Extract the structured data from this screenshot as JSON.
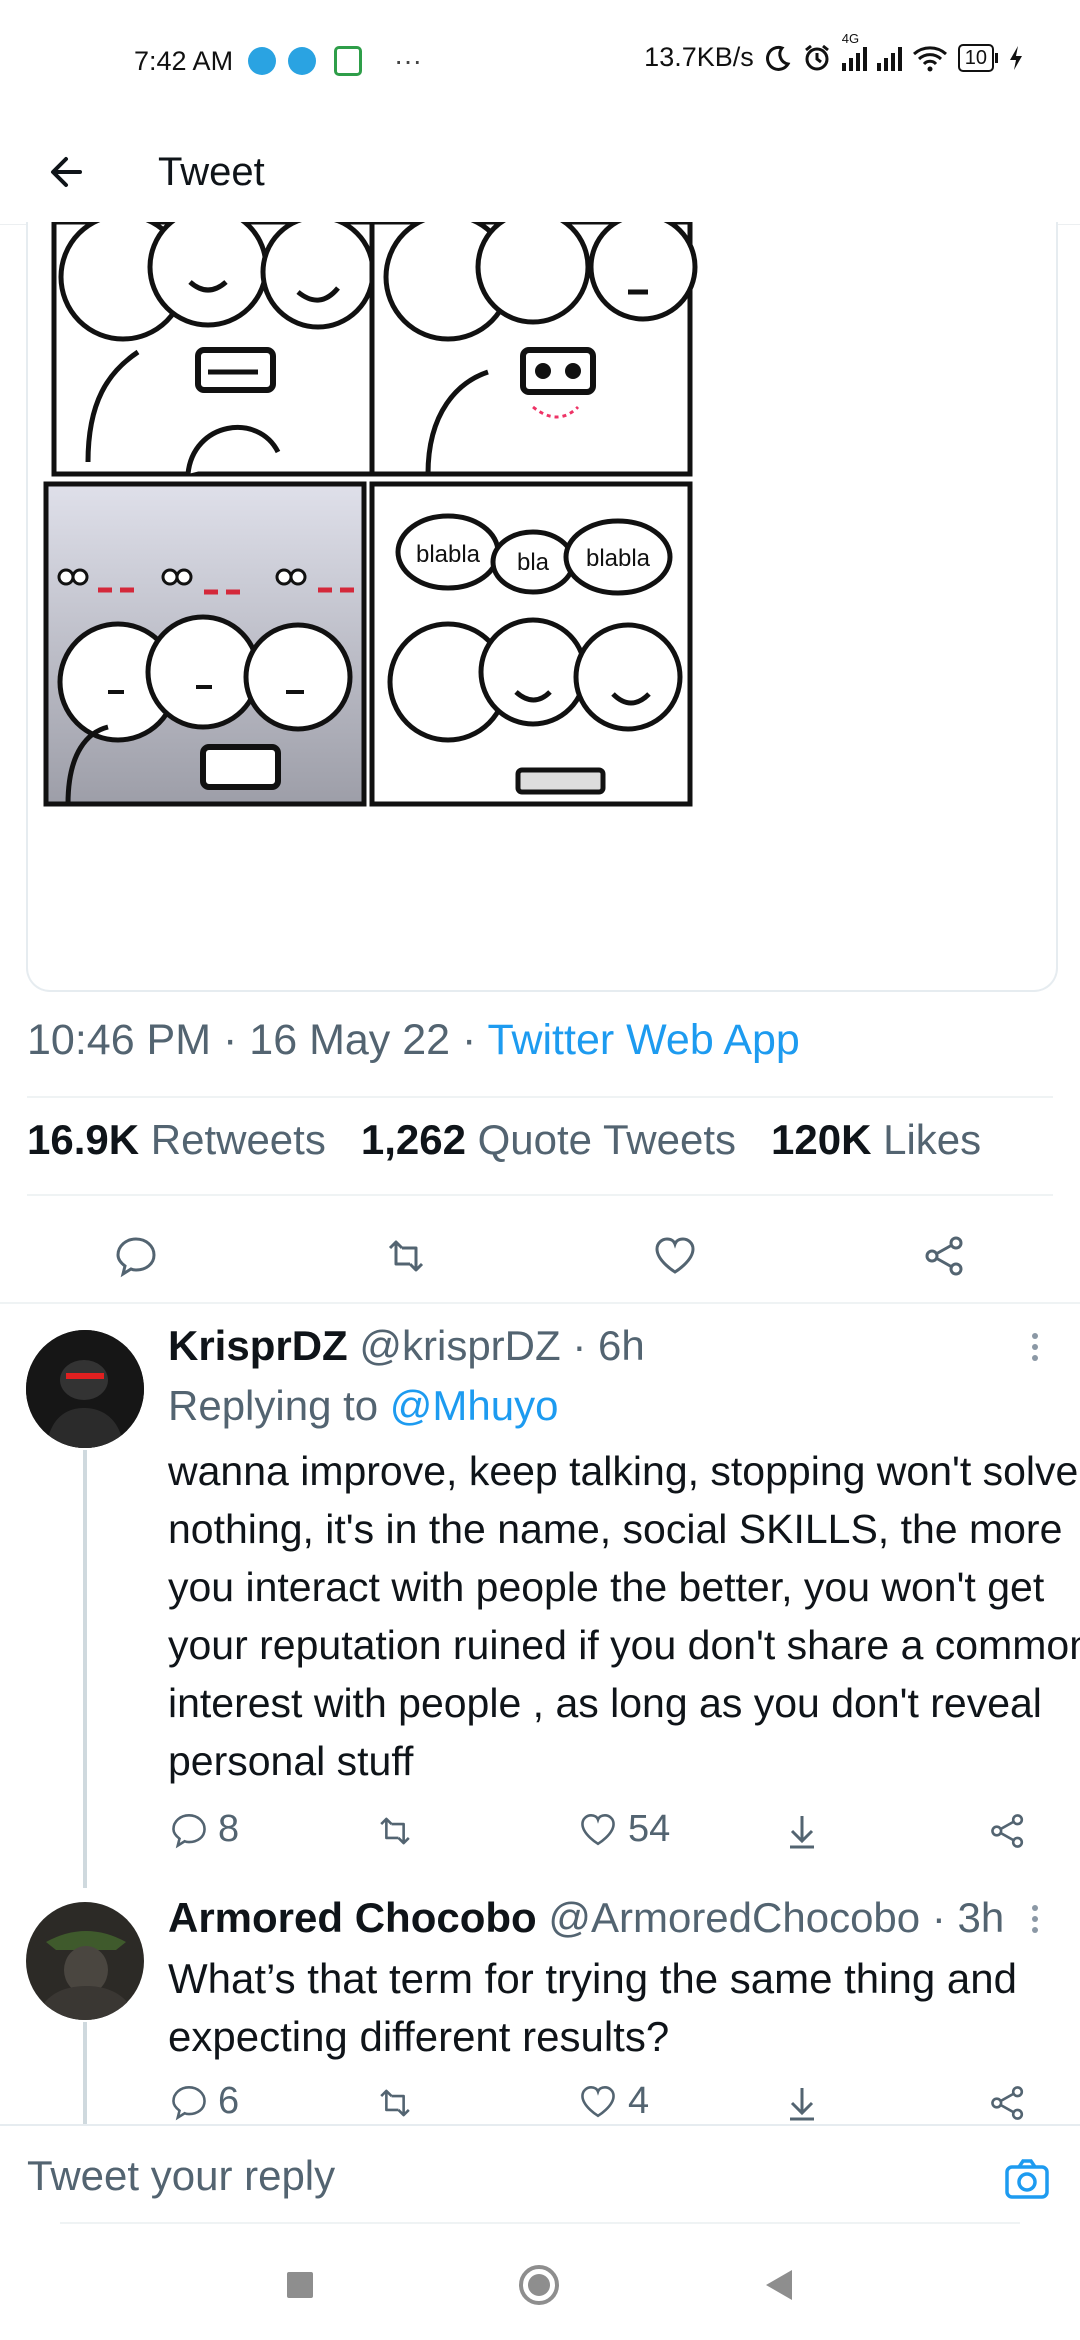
{
  "status_bar": {
    "time": "7:42 AM",
    "more": "···",
    "network_speed": "13.7KB/s",
    "network_label": "4G",
    "battery": "10"
  },
  "header": {
    "title": "Tweet"
  },
  "tweet": {
    "comic": {
      "bubbles": [
        "blabla",
        "bla",
        "blabla"
      ]
    },
    "time": "10:46 PM",
    "date": "16 May 22",
    "separator": "·",
    "source": "Twitter Web App",
    "stats": {
      "retweets_count": "16.9K",
      "retweets_label": "Retweets",
      "quotes_count": "1,262",
      "quotes_label": "Quote Tweets",
      "likes_count": "120K",
      "likes_label": "Likes"
    }
  },
  "replies": [
    {
      "name": "KrisprDZ",
      "handle": "@krisprDZ · 6h",
      "replying_prefix": "Replying to",
      "replying_to": "@Mhuyo",
      "text": "wanna improve, keep talking, stopping won't solve nothing, it's in the name, social SKILLS, the more you interact with people the better, you won't get your reputation ruined if you don't share a common interest with people , as long as you don't reveal personal stuff",
      "reply_count": "8",
      "like_count": "54"
    },
    {
      "name": "Armored Chocobo",
      "handle": "@ArmoredChocobo · 3h",
      "text": "What’s that term for trying the same thing and expecting different results?",
      "reply_count": "6",
      "like_count": "4"
    }
  ],
  "reply_bar": {
    "placeholder": "Tweet your reply"
  },
  "colors": {
    "accent": "#1d9bf0",
    "muted": "#536471",
    "text": "#0f1419"
  }
}
